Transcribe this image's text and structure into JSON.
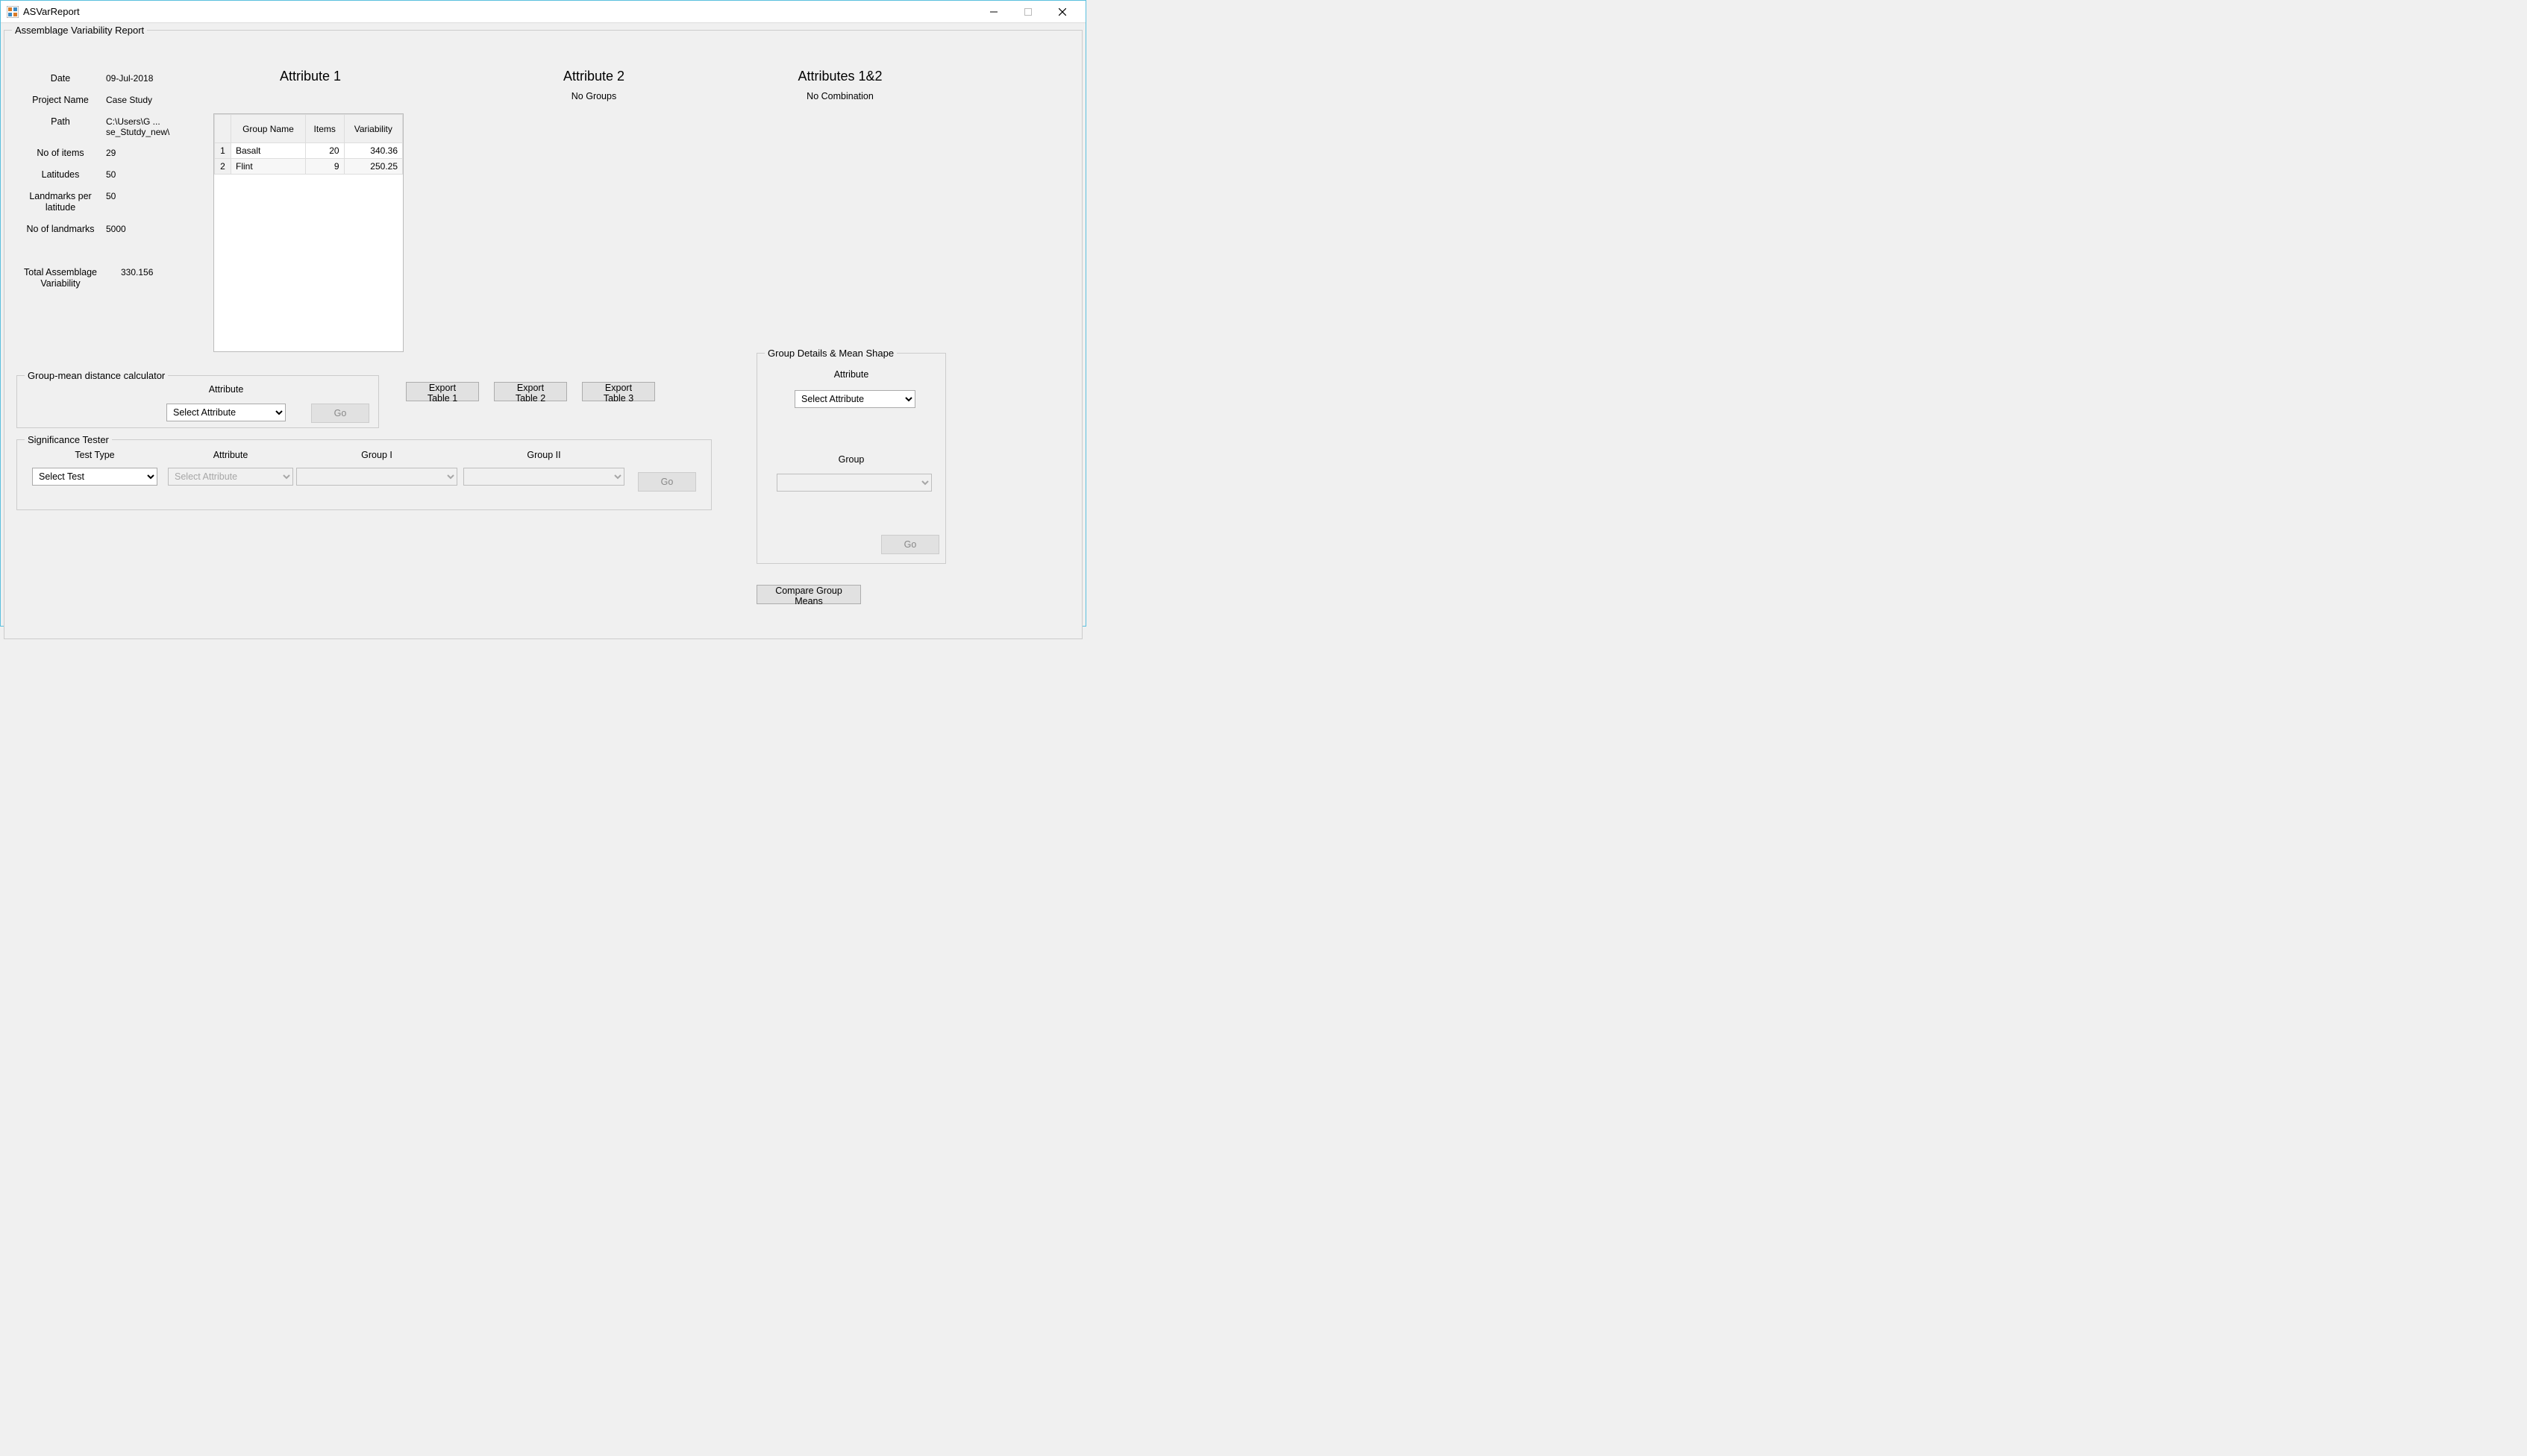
{
  "window": {
    "title": "ASVarReport"
  },
  "main_legend": "Assemblage Variability Report",
  "meta": {
    "labels": {
      "date": "Date",
      "project": "Project Name",
      "path": "Path",
      "items": "No of items",
      "lat": "Latitudes",
      "lpl": "Landmarks per latitude",
      "lmk": "No of landmarks",
      "tav": "Total Assemblage Variability"
    },
    "values": {
      "date": "09-Jul-2018",
      "project": "Case Study",
      "path": "C:\\Users\\G ... se_Stutdy_new\\",
      "items": "29",
      "lat": "50",
      "lpl": "50",
      "lmk": "5000",
      "tav": "330.156"
    }
  },
  "attrs": {
    "a1": "Attribute 1",
    "a2": "Attribute 2",
    "a12": "Attributes 1&2",
    "no_groups": "No Groups",
    "no_combo": "No Combination"
  },
  "table1": {
    "headers": {
      "group": "Group Name",
      "items": "Items",
      "var": "Variability"
    },
    "rows": [
      {
        "idx": "1",
        "name": "Basalt",
        "items": "20",
        "var": "340.36"
      },
      {
        "idx": "2",
        "name": "Flint",
        "items": "9",
        "var": "250.25"
      }
    ]
  },
  "gm": {
    "legend": "Group-mean distance calculator",
    "attr_label": "Attribute",
    "select_placeholder": "Select Attribute",
    "go": "Go"
  },
  "exports": {
    "t1": "Export Table 1",
    "t2": "Export Table 2",
    "t3": "Export Table 3"
  },
  "sig": {
    "legend": "Significance Tester",
    "test_label": "Test Type",
    "attr_label": "Attribute",
    "g1_label": "Group I",
    "g2_label": "Group II",
    "select_test": "Select Test",
    "select_attr": "Select Attribute",
    "go": "Go"
  },
  "gd": {
    "legend": "Group Details & Mean Shape",
    "attr_label": "Attribute",
    "group_label": "Group",
    "select_attr": "Select Attribute",
    "go": "Go"
  },
  "compare": "Compare Group Means"
}
